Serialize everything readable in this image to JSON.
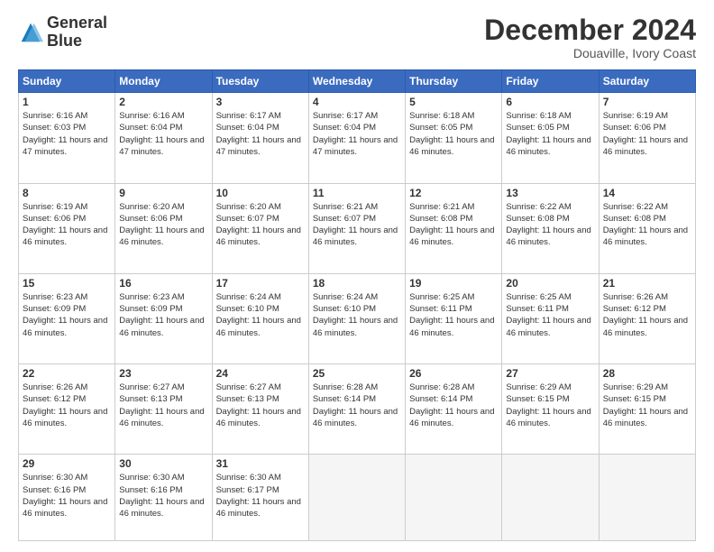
{
  "header": {
    "logo_line1": "General",
    "logo_line2": "Blue",
    "month": "December 2024",
    "location": "Douaville, Ivory Coast"
  },
  "weekdays": [
    "Sunday",
    "Monday",
    "Tuesday",
    "Wednesday",
    "Thursday",
    "Friday",
    "Saturday"
  ],
  "weeks": [
    [
      {
        "day": "1",
        "sunrise": "6:16 AM",
        "sunset": "6:03 PM",
        "daylight": "11 hours and 47 minutes."
      },
      {
        "day": "2",
        "sunrise": "6:16 AM",
        "sunset": "6:04 PM",
        "daylight": "11 hours and 47 minutes."
      },
      {
        "day": "3",
        "sunrise": "6:17 AM",
        "sunset": "6:04 PM",
        "daylight": "11 hours and 47 minutes."
      },
      {
        "day": "4",
        "sunrise": "6:17 AM",
        "sunset": "6:04 PM",
        "daylight": "11 hours and 47 minutes."
      },
      {
        "day": "5",
        "sunrise": "6:18 AM",
        "sunset": "6:05 PM",
        "daylight": "11 hours and 46 minutes."
      },
      {
        "day": "6",
        "sunrise": "6:18 AM",
        "sunset": "6:05 PM",
        "daylight": "11 hours and 46 minutes."
      },
      {
        "day": "7",
        "sunrise": "6:19 AM",
        "sunset": "6:06 PM",
        "daylight": "11 hours and 46 minutes."
      }
    ],
    [
      {
        "day": "8",
        "sunrise": "6:19 AM",
        "sunset": "6:06 PM",
        "daylight": "11 hours and 46 minutes."
      },
      {
        "day": "9",
        "sunrise": "6:20 AM",
        "sunset": "6:06 PM",
        "daylight": "11 hours and 46 minutes."
      },
      {
        "day": "10",
        "sunrise": "6:20 AM",
        "sunset": "6:07 PM",
        "daylight": "11 hours and 46 minutes."
      },
      {
        "day": "11",
        "sunrise": "6:21 AM",
        "sunset": "6:07 PM",
        "daylight": "11 hours and 46 minutes."
      },
      {
        "day": "12",
        "sunrise": "6:21 AM",
        "sunset": "6:08 PM",
        "daylight": "11 hours and 46 minutes."
      },
      {
        "day": "13",
        "sunrise": "6:22 AM",
        "sunset": "6:08 PM",
        "daylight": "11 hours and 46 minutes."
      },
      {
        "day": "14",
        "sunrise": "6:22 AM",
        "sunset": "6:08 PM",
        "daylight": "11 hours and 46 minutes."
      }
    ],
    [
      {
        "day": "15",
        "sunrise": "6:23 AM",
        "sunset": "6:09 PM",
        "daylight": "11 hours and 46 minutes."
      },
      {
        "day": "16",
        "sunrise": "6:23 AM",
        "sunset": "6:09 PM",
        "daylight": "11 hours and 46 minutes."
      },
      {
        "day": "17",
        "sunrise": "6:24 AM",
        "sunset": "6:10 PM",
        "daylight": "11 hours and 46 minutes."
      },
      {
        "day": "18",
        "sunrise": "6:24 AM",
        "sunset": "6:10 PM",
        "daylight": "11 hours and 46 minutes."
      },
      {
        "day": "19",
        "sunrise": "6:25 AM",
        "sunset": "6:11 PM",
        "daylight": "11 hours and 46 minutes."
      },
      {
        "day": "20",
        "sunrise": "6:25 AM",
        "sunset": "6:11 PM",
        "daylight": "11 hours and 46 minutes."
      },
      {
        "day": "21",
        "sunrise": "6:26 AM",
        "sunset": "6:12 PM",
        "daylight": "11 hours and 46 minutes."
      }
    ],
    [
      {
        "day": "22",
        "sunrise": "6:26 AM",
        "sunset": "6:12 PM",
        "daylight": "11 hours and 46 minutes."
      },
      {
        "day": "23",
        "sunrise": "6:27 AM",
        "sunset": "6:13 PM",
        "daylight": "11 hours and 46 minutes."
      },
      {
        "day": "24",
        "sunrise": "6:27 AM",
        "sunset": "6:13 PM",
        "daylight": "11 hours and 46 minutes."
      },
      {
        "day": "25",
        "sunrise": "6:28 AM",
        "sunset": "6:14 PM",
        "daylight": "11 hours and 46 minutes."
      },
      {
        "day": "26",
        "sunrise": "6:28 AM",
        "sunset": "6:14 PM",
        "daylight": "11 hours and 46 minutes."
      },
      {
        "day": "27",
        "sunrise": "6:29 AM",
        "sunset": "6:15 PM",
        "daylight": "11 hours and 46 minutes."
      },
      {
        "day": "28",
        "sunrise": "6:29 AM",
        "sunset": "6:15 PM",
        "daylight": "11 hours and 46 minutes."
      }
    ],
    [
      {
        "day": "29",
        "sunrise": "6:30 AM",
        "sunset": "6:16 PM",
        "daylight": "11 hours and 46 minutes."
      },
      {
        "day": "30",
        "sunrise": "6:30 AM",
        "sunset": "6:16 PM",
        "daylight": "11 hours and 46 minutes."
      },
      {
        "day": "31",
        "sunrise": "6:30 AM",
        "sunset": "6:17 PM",
        "daylight": "11 hours and 46 minutes."
      },
      null,
      null,
      null,
      null
    ]
  ]
}
